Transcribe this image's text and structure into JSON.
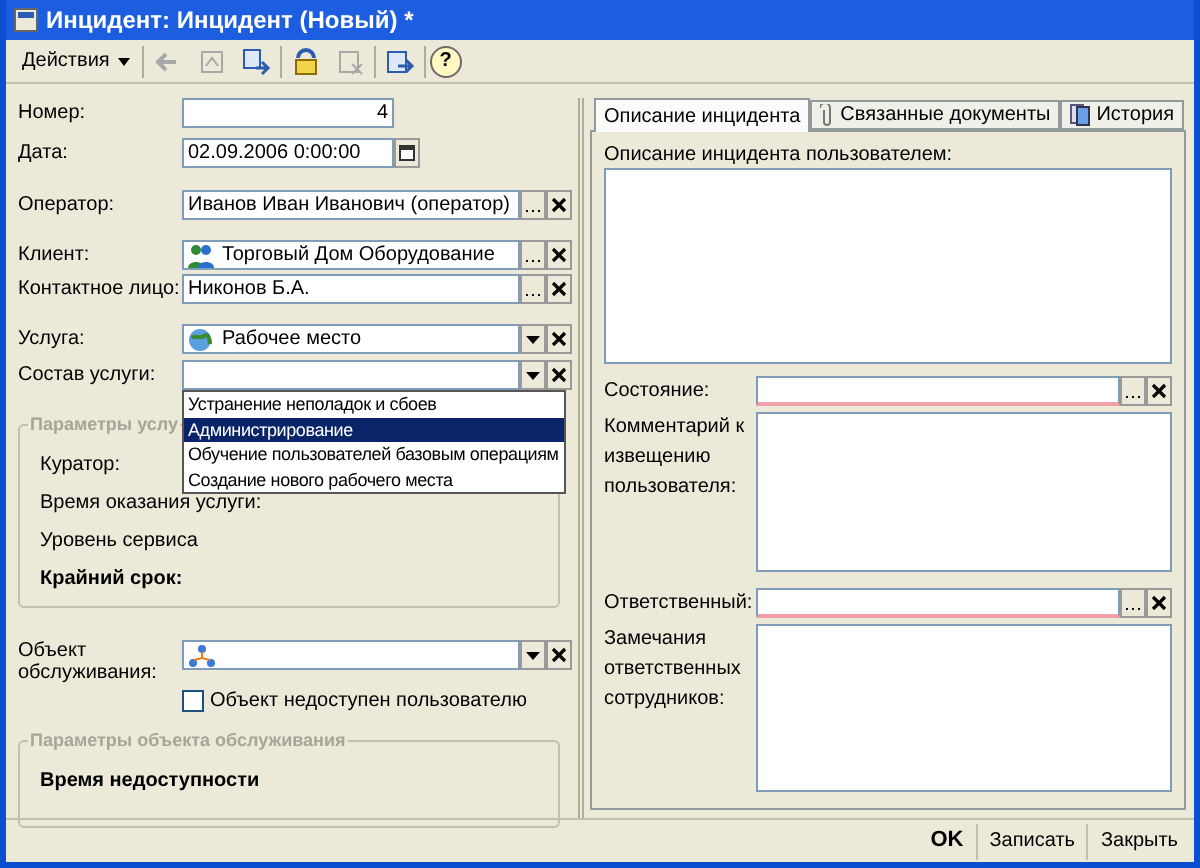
{
  "window": {
    "title": "Инцидент: Инцидент (Новый) *"
  },
  "toolbar": {
    "menu": "Действия",
    "buttons": [
      {
        "kind": "back",
        "disabled": true
      },
      {
        "kind": "doc",
        "disabled": true
      },
      {
        "kind": "arrows",
        "disabled": false
      },
      {
        "kind": "refresh",
        "disabled": false
      },
      {
        "kind": "delete",
        "disabled": true
      },
      {
        "kind": "based",
        "disabled": false
      }
    ],
    "help": "?"
  },
  "fields": [
    {
      "kind": "number",
      "label": "Номер:",
      "value": "4"
    },
    {
      "kind": "date",
      "label": "Дата:",
      "value": "02.09.2006  0:00:00"
    },
    {
      "kind": "ref",
      "label": "Оператор:",
      "value": "Иванов Иван Иванович (оператор)"
    },
    {
      "kind": "ref",
      "label": "Клиент:",
      "value": "Торговый Дом Оборудование"
    },
    {
      "kind": "ref",
      "label": "Контактное лицо:",
      "value": "Никонов Б.А."
    },
    {
      "kind": "select",
      "label": "Услуга:",
      "value": "Рабочее место"
    },
    {
      "kind": "select",
      "label": "Состав услуги:"
    }
  ],
  "dropdown": [
    {
      "text": "Устранение неполадок и сбоев",
      "selected": false
    },
    {
      "text": "Администрирование",
      "selected": true
    },
    {
      "text": "Обучение пользователей базовым операциям",
      "selected": false
    },
    {
      "text": "Создание нового рабочего места",
      "selected": false
    }
  ],
  "service_group": {
    "title": "Параметры услу",
    "items": [
      {
        "text": "Куратор:",
        "bold": false
      },
      {
        "text": "Время оказания услуги:",
        "bold": false
      },
      {
        "text": "Уровень сервиса",
        "bold": false
      },
      {
        "text": "Крайний срок:",
        "bold": true
      }
    ]
  },
  "object": {
    "label": "Объект обслуживания:",
    "checkbox": {
      "label": "Объект недоступен пользователю",
      "checked": false
    }
  },
  "object_group": {
    "title": "Параметры объекта обслуживания",
    "items": [
      {
        "text": "Время недоступности",
        "bold": true
      }
    ]
  },
  "tabs": [
    {
      "label": "Описание инцидента",
      "selected": true
    },
    {
      "label": "Связанные документы",
      "selected": false
    },
    {
      "label": "История",
      "selected": false
    }
  ],
  "description": {
    "label": "Описание инцидента пользователем:"
  },
  "state": {
    "label": "Состояние:",
    "required": true
  },
  "comment": {
    "label": "Комментарий к извещению пользователя:"
  },
  "responsible": {
    "label": "Ответственный:",
    "required": true
  },
  "remarks": {
    "label": "Замечания ответственных сотрудников:"
  },
  "footer": [
    {
      "label": "OK",
      "default": true
    },
    {
      "label": "Записать",
      "default": false
    },
    {
      "label": "Закрыть",
      "default": false
    }
  ]
}
